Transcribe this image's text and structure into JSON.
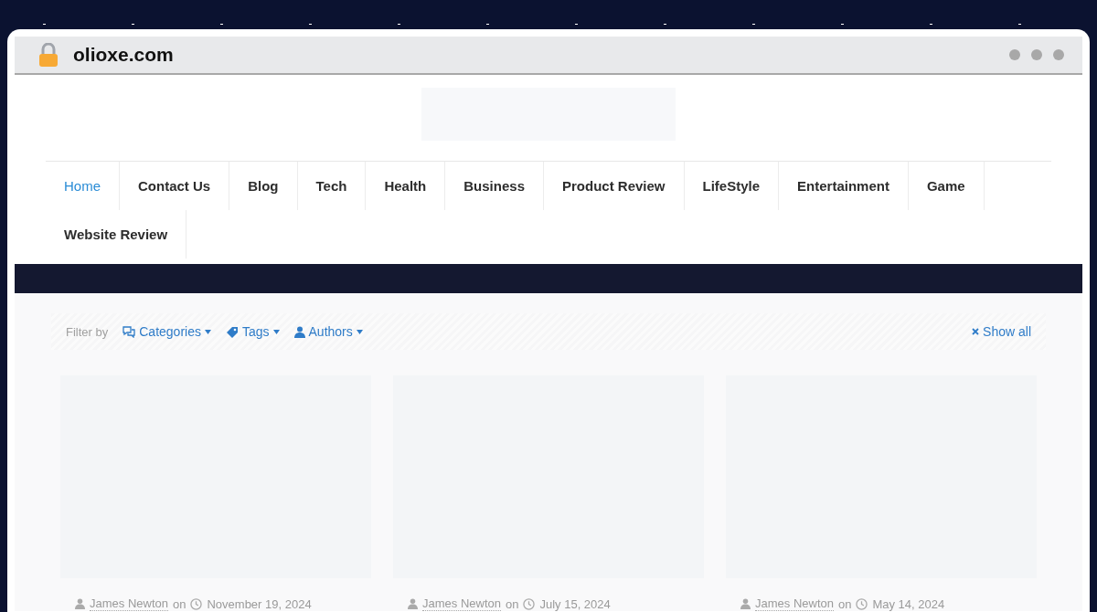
{
  "browser": {
    "domain": "olioxe.com"
  },
  "nav": [
    {
      "label": "Home",
      "selected": true
    },
    {
      "label": "Contact Us",
      "selected": false
    },
    {
      "label": "Blog",
      "selected": false
    },
    {
      "label": "Tech",
      "selected": false
    },
    {
      "label": "Health",
      "selected": false
    },
    {
      "label": "Business",
      "selected": false
    },
    {
      "label": "Product Review",
      "selected": false
    },
    {
      "label": "LifeStyle",
      "selected": false
    },
    {
      "label": "Entertainment",
      "selected": false
    },
    {
      "label": "Game",
      "selected": false
    },
    {
      "label": "Website Review",
      "selected": false
    }
  ],
  "filter": {
    "label": "Filter by",
    "items": [
      {
        "kind": "categories",
        "label": "Categories"
      },
      {
        "kind": "tags",
        "label": "Tags"
      },
      {
        "kind": "authors",
        "label": "Authors"
      }
    ],
    "show_all": "Show all"
  },
  "posts": [
    {
      "author": "James Newton",
      "on": "on",
      "date": "November 19, 2024"
    },
    {
      "author": "James Newton",
      "on": "on",
      "date": "July 15, 2024"
    },
    {
      "author": "James Newton",
      "on": "on",
      "date": "May 14, 2024"
    }
  ]
}
